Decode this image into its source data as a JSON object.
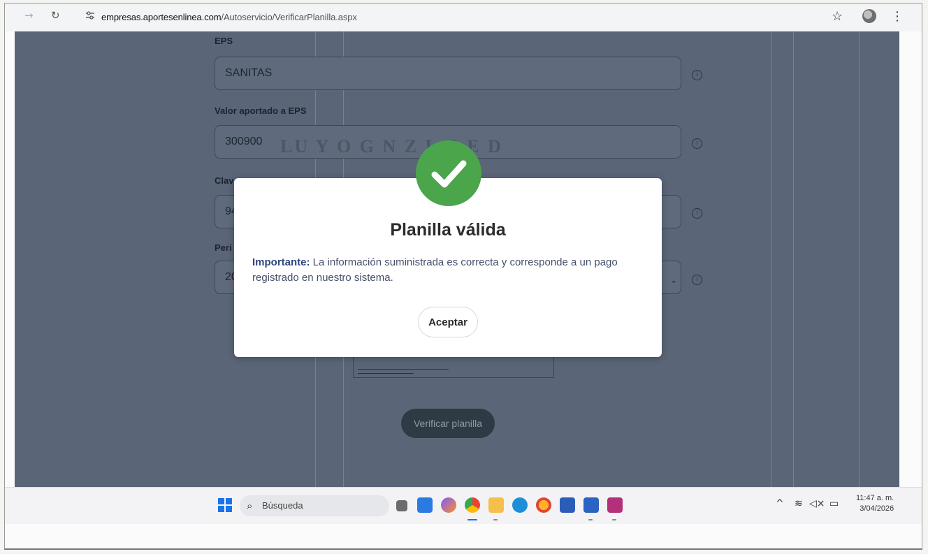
{
  "browser": {
    "url_domain": "empresas.aportesenlinea.com",
    "url_path": "/Autoservicio/VerificarPlanilla.aspx"
  },
  "form": {
    "eps_label": "EPS",
    "eps_value": "SANITAS",
    "valor_label": "Valor aportado a EPS",
    "valor_value": "300900",
    "clave_label": "Clav",
    "clave_value": "94",
    "periodo_label": "Peri",
    "periodo_value": "20",
    "verify_button": "Verificar planilla"
  },
  "modal": {
    "title": "Planilla válida",
    "important_label": "Importante:",
    "message": "La información suministrada es correcta y corresponde a un pago registrado en nuestro sistema.",
    "accept_button": "Aceptar"
  },
  "taskbar": {
    "search_placeholder": "Búsqueda",
    "time": "11:47 a. m.",
    "date": "3/04/2026"
  },
  "colors": {
    "overlay": "#5a6577",
    "success": "#4aa54b",
    "important_text": "#2f4680"
  }
}
